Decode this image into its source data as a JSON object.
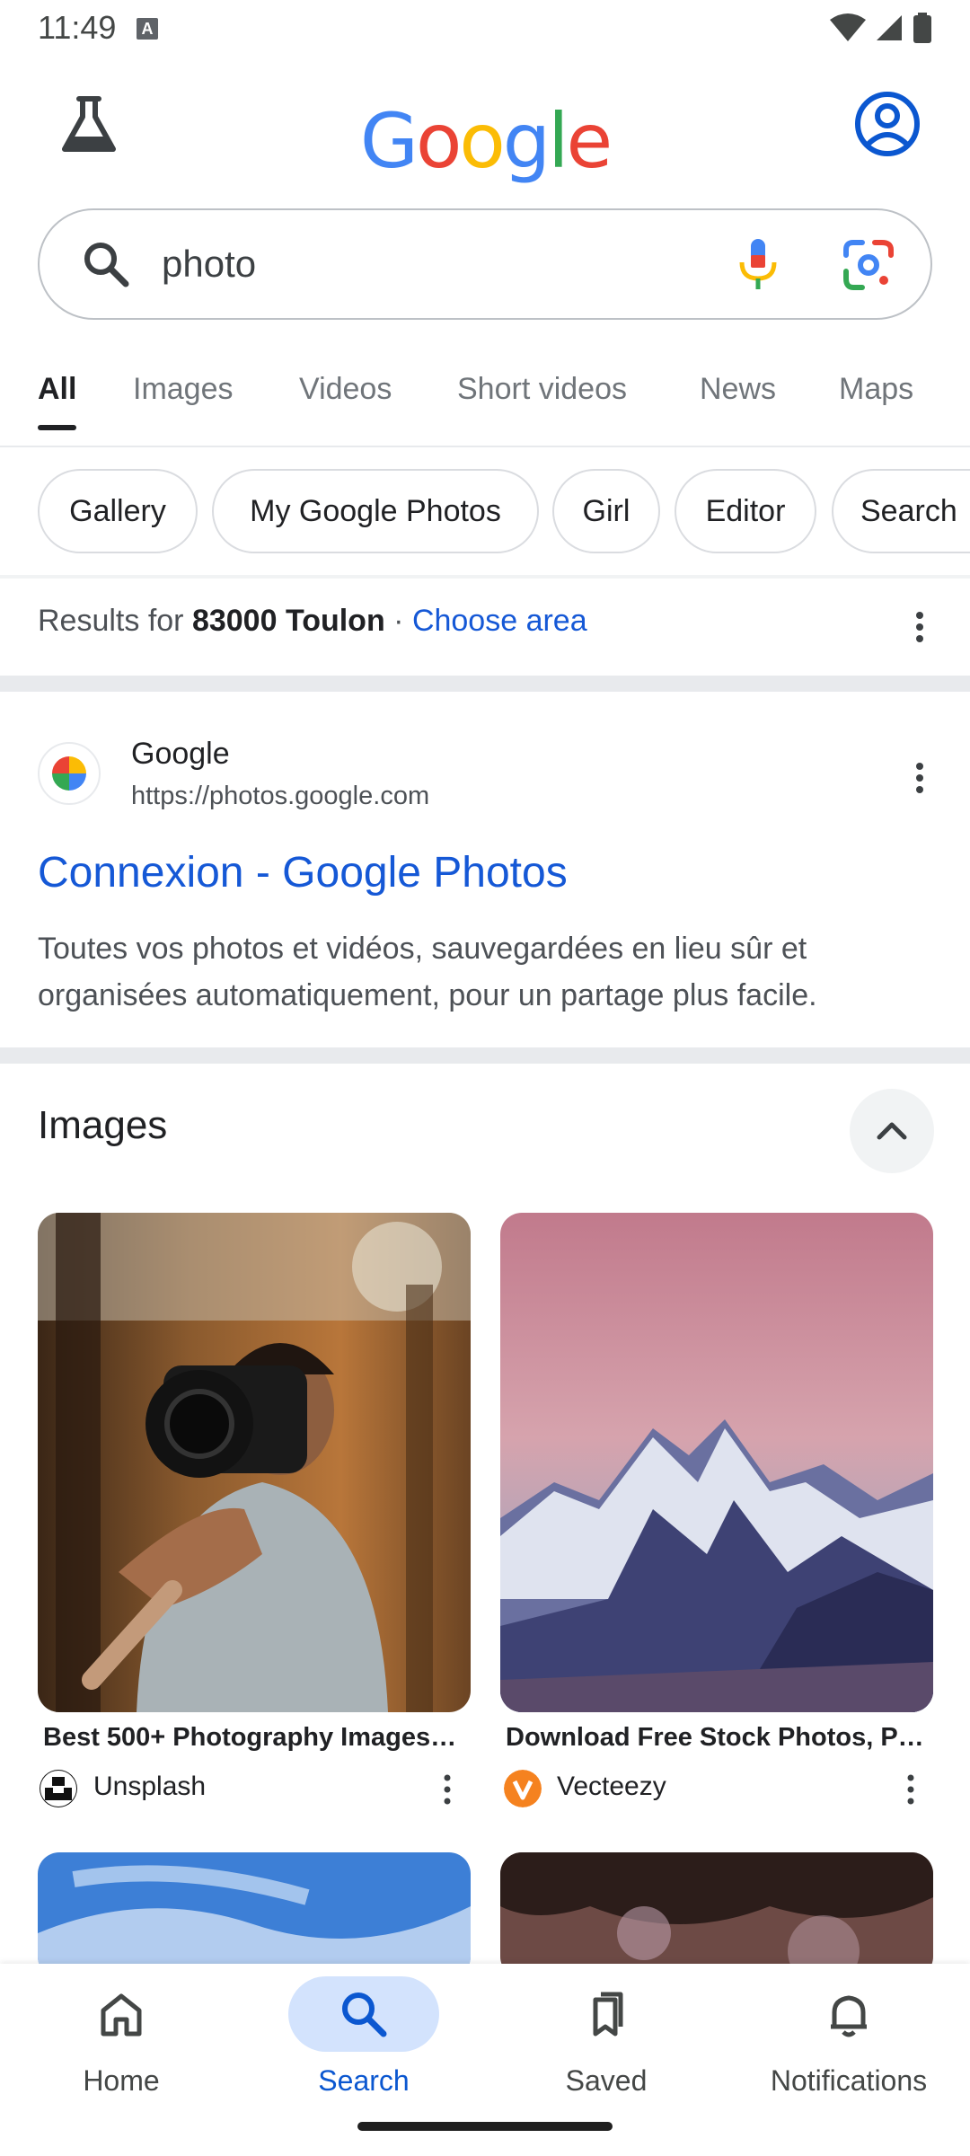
{
  "status": {
    "time": "11:49",
    "a_badge": "A"
  },
  "header": {
    "logo_letters": [
      {
        "char": "G",
        "color": "#4285F4"
      },
      {
        "char": "o",
        "color": "#EA4335"
      },
      {
        "char": "o",
        "color": "#FBBC05"
      },
      {
        "char": "g",
        "color": "#4285F4"
      },
      {
        "char": "l",
        "color": "#34A853"
      },
      {
        "char": "e",
        "color": "#EA4335"
      }
    ]
  },
  "search": {
    "query": "photo"
  },
  "tabs": [
    {
      "label": "All",
      "active": true
    },
    {
      "label": "Images"
    },
    {
      "label": "Videos"
    },
    {
      "label": "Short videos"
    },
    {
      "label": "News"
    },
    {
      "label": "Maps"
    }
  ],
  "chips": [
    "Gallery",
    "My Google Photos",
    "Girl",
    "Editor",
    "Search"
  ],
  "location": {
    "prefix": "Results for ",
    "place": "83000 Toulon",
    "separator": " · ",
    "link": "Choose area"
  },
  "result": {
    "site_name": "Google",
    "url": "https://photos.google.com",
    "title": "Connexion - Google Photos",
    "snippet": "Toutes vos photos et vidéos, sauvegardées en lieu sûr et organisées automatiquement, pour un partage plus facile."
  },
  "images_section": {
    "title": "Images",
    "items": [
      {
        "caption": "Best 500+ Photography Images…",
        "source": "Unsplash"
      },
      {
        "caption": "Download Free Stock Photos, Pi…",
        "source": "Vecteezy"
      }
    ]
  },
  "bottom_nav": [
    {
      "label": "Home",
      "icon": "home-icon"
    },
    {
      "label": "Search",
      "icon": "search-icon",
      "active": true
    },
    {
      "label": "Saved",
      "icon": "bookmark-icon"
    },
    {
      "label": "Notifications",
      "icon": "bell-icon"
    }
  ],
  "colors": {
    "link": "#1558d6",
    "nav_active": "#0b57d0",
    "nav_active_bg": "#d3e3fd"
  }
}
